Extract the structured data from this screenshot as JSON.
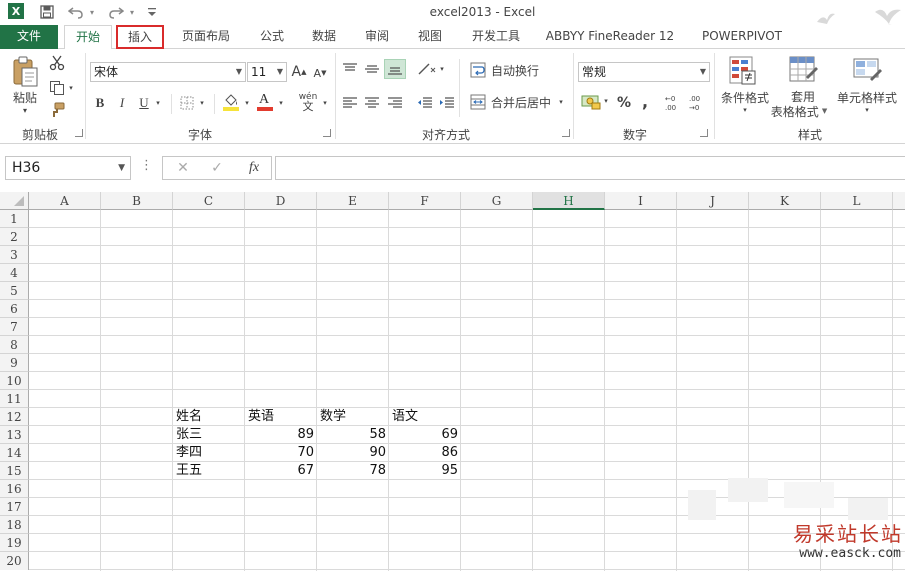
{
  "window": {
    "title": "excel2013 - Excel",
    "app_logo": "X"
  },
  "qat": {
    "save_icon": "save-icon",
    "undo_icon": "undo-icon",
    "redo_icon": "redo-icon",
    "customize_icon": "customize-qat-icon"
  },
  "tabs": [
    {
      "label": "文件"
    },
    {
      "label": "开始"
    },
    {
      "label": "插入"
    },
    {
      "label": "页面布局"
    },
    {
      "label": "公式"
    },
    {
      "label": "数据"
    },
    {
      "label": "审阅"
    },
    {
      "label": "视图"
    },
    {
      "label": "开发工具"
    },
    {
      "label": "ABBYY FineReader 12"
    },
    {
      "label": "POWERPIVOT"
    }
  ],
  "ribbon": {
    "clipboard": {
      "label": "剪贴板",
      "paste": "粘贴"
    },
    "font": {
      "label": "字体",
      "name": "宋体",
      "size": "11",
      "bold": "B",
      "italic": "I",
      "underline": "U",
      "grow": "A",
      "shrink": "A",
      "pinyin": "wén",
      "font_color": "A"
    },
    "alignment": {
      "label": "对齐方式",
      "wrap_text": "自动换行",
      "merge_center": "合并后居中"
    },
    "number": {
      "label": "数字",
      "format": "常规",
      "percent": "%",
      "comma": ",",
      "inc_decimal": "+.0 .00",
      "dec_decimal": ".00 +.0"
    },
    "styles": {
      "label": "样式",
      "conditional": "条件格式",
      "table_format_1": "套用",
      "table_format_2": "表格格式",
      "cell_styles": "单元格样式"
    }
  },
  "formula_bar": {
    "name_box": "H36",
    "fx": "fx",
    "cancel": "✕",
    "enter": "✓",
    "more": "⋮",
    "formula": ""
  },
  "columns": [
    "A",
    "B",
    "C",
    "D",
    "E",
    "F",
    "G",
    "H",
    "I",
    "J",
    "K",
    "L"
  ],
  "selected_column": "H",
  "rows": [
    "1",
    "2",
    "3",
    "4",
    "5",
    "6",
    "7",
    "8",
    "9",
    "10",
    "11",
    "12",
    "13",
    "14",
    "15",
    "16",
    "17",
    "18",
    "19",
    "20"
  ],
  "table": {
    "header": [
      "姓名",
      "英语",
      "数学",
      "语文"
    ],
    "rows": [
      {
        "name": "张三",
        "english": "89",
        "math": "58",
        "chinese": "69"
      },
      {
        "name": "李四",
        "english": "70",
        "math": "90",
        "chinese": "86"
      },
      {
        "name": "王五",
        "english": "67",
        "math": "78",
        "chinese": "95"
      }
    ]
  },
  "watermark": {
    "text": "易采站长站",
    "url": "www.easck.com"
  },
  "colors": {
    "accent": "#217346",
    "highlight_box": "#d92b2b",
    "fill_yellow": "#f6e33a",
    "font_red": "#e23b2e"
  }
}
